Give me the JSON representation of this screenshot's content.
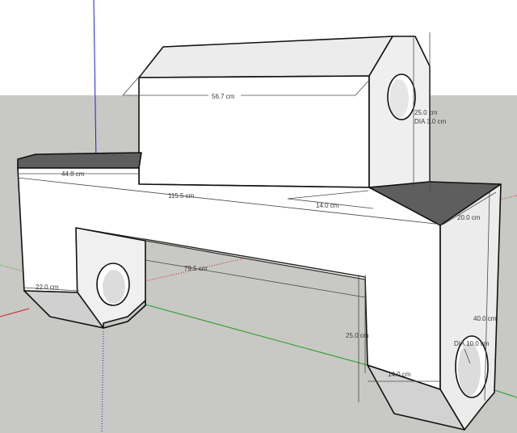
{
  "window": {
    "title": ""
  },
  "colors": {
    "sky": "#ffffff",
    "ground": "#c8c8c4",
    "face_front": "#ffffff",
    "face_light": "#efefef",
    "face_mid": "#e4e4e4",
    "face_dark": "#5a5a5a",
    "face_bottom": "#d2d2d2",
    "hole_inner": "#d9d9d9",
    "axis_blue": "#1f1fd8",
    "axis_red": "#cc2222",
    "axis_green": "#22a022"
  },
  "dimensions": {
    "top_length": "56.7 cm",
    "shaft_height": "25.0 cm",
    "shaft_hole": "DIA 3.0 cm",
    "step_width": "44.8 cm",
    "total_length": "115.5 cm",
    "shaft_depth": "14.0 cm",
    "body_depth": "20.0 cm",
    "inner_span": "79.5 cm",
    "left_foot_width": "22.0 cm",
    "body_height": "40.0 cm",
    "right_hole": "DIA 10.0 cm",
    "leg_height": "25.0 cm",
    "foot_depth": "14.0 cm"
  }
}
